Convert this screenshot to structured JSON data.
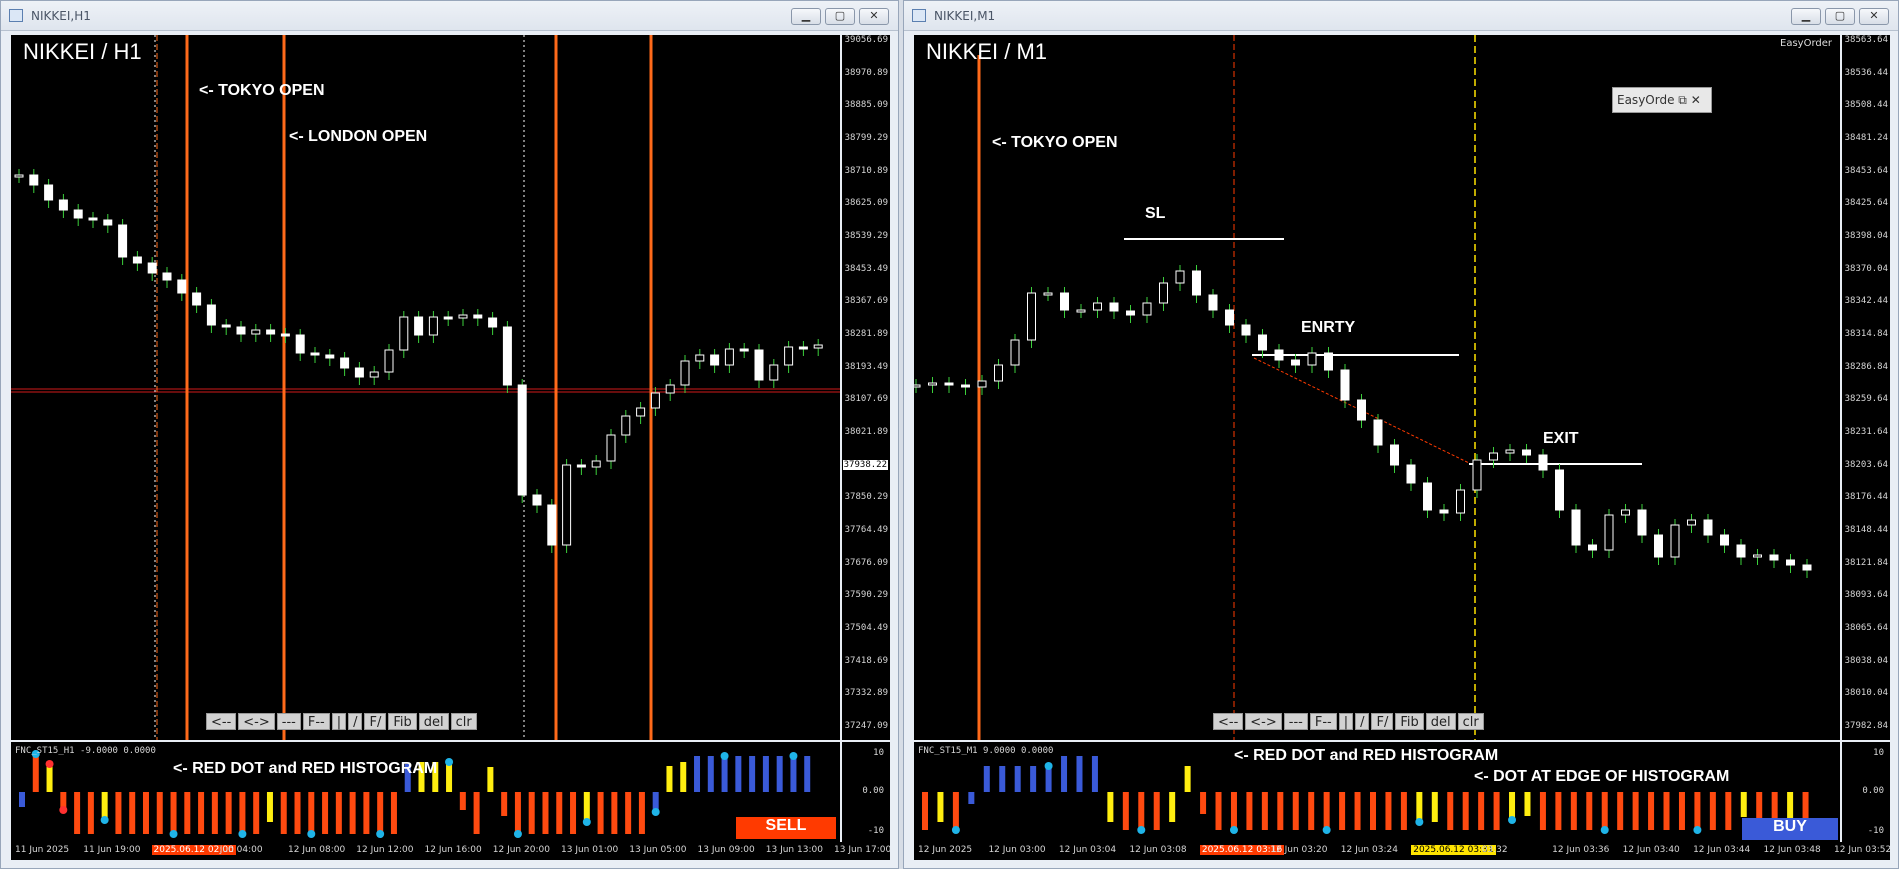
{
  "left": {
    "window_title": "NIKKEI,H1",
    "chart_title": "NIKKEI / H1",
    "labels": {
      "tokyo": "<- TOKYO OPEN",
      "london": "<- LONDON OPEN",
      "red": "<- RED DOT and RED HISTOGRAM"
    },
    "price_labels": [
      "39056.69",
      "38970.89",
      "38885.09",
      "38799.29",
      "38710.89",
      "38625.09",
      "38539.29",
      "38453.49",
      "38367.69",
      "38281.89",
      "38193.49",
      "38107.69",
      "38021.89",
      "37938.22",
      "37850.29",
      "37764.49",
      "37676.09",
      "37590.29",
      "37504.49",
      "37418.69",
      "37332.89",
      "37247.09"
    ],
    "current_price": "37938.22",
    "indicator_label": "FNC_ST15_H1 -9.0000 0.0000",
    "ind_scale": [
      "10",
      "0.00",
      "-10"
    ],
    "time_labels": [
      "11 Jun 2025",
      "11 Jun 19:00",
      "2025.06.12 02:00",
      "Jun 04:00",
      "12 Jun 08:00",
      "12 Jun 12:00",
      "12 Jun 16:00",
      "12 Jun 20:00",
      "13 Jun 01:00",
      "13 Jun 05:00",
      "13 Jun 09:00",
      "13 Jun 13:00",
      "13 Jun 17:00"
    ],
    "tools": [
      "<--",
      "<->",
      "---",
      "F--",
      "|",
      "/",
      "F/",
      "Fib",
      "del",
      "clr"
    ],
    "signal": "SELL",
    "signal_color": "#ff3a00"
  },
  "right": {
    "window_title": "NIKKEI,M1",
    "chart_title": "NIKKEI / M1",
    "labels": {
      "tokyo": "<- TOKYO OPEN",
      "sl": "SL",
      "entry": "ENRTY",
      "exit": "EXIT",
      "red": "<- RED DOT and RED HISTOGRAM",
      "dot": "<- DOT AT EDGE OF HISTOGRAM"
    },
    "easyorder": "EasyOrder",
    "easyorder_box": "EasyOrde",
    "price_labels": [
      "38563.64",
      "38536.44",
      "38508.44",
      "38481.24",
      "38453.64",
      "38425.64",
      "38398.04",
      "38370.04",
      "38342.44",
      "38314.84",
      "38286.84",
      "38259.64",
      "38231.64",
      "38203.64",
      "38176.44",
      "38148.44",
      "38121.84",
      "38093.64",
      "38065.64",
      "38038.04",
      "38010.04",
      "37982.84"
    ],
    "indicator_label": "FNC_ST15_M1 9.0000 0.0000",
    "ind_scale": [
      "10",
      "0.00",
      "-10"
    ],
    "time_labels": [
      "12 Jun 2025",
      "12 Jun 03:00",
      "12 Jun 03:04",
      "12 Jun 03:08",
      "2025.06.12 03:16",
      "12 Jun 03:20",
      "12 Jun 03:24",
      "2025.06.12 03:31",
      "03:32",
      "12 Jun 03:36",
      "12 Jun 03:40",
      "12 Jun 03:44",
      "12 Jun 03:48",
      "12 Jun 03:52"
    ],
    "tools": [
      "<--",
      "<->",
      "---",
      "F--",
      "|",
      "/",
      "F/",
      "Fib",
      "del",
      "clr"
    ],
    "signal": "BUY",
    "signal_color": "#3a5ad8"
  }
}
